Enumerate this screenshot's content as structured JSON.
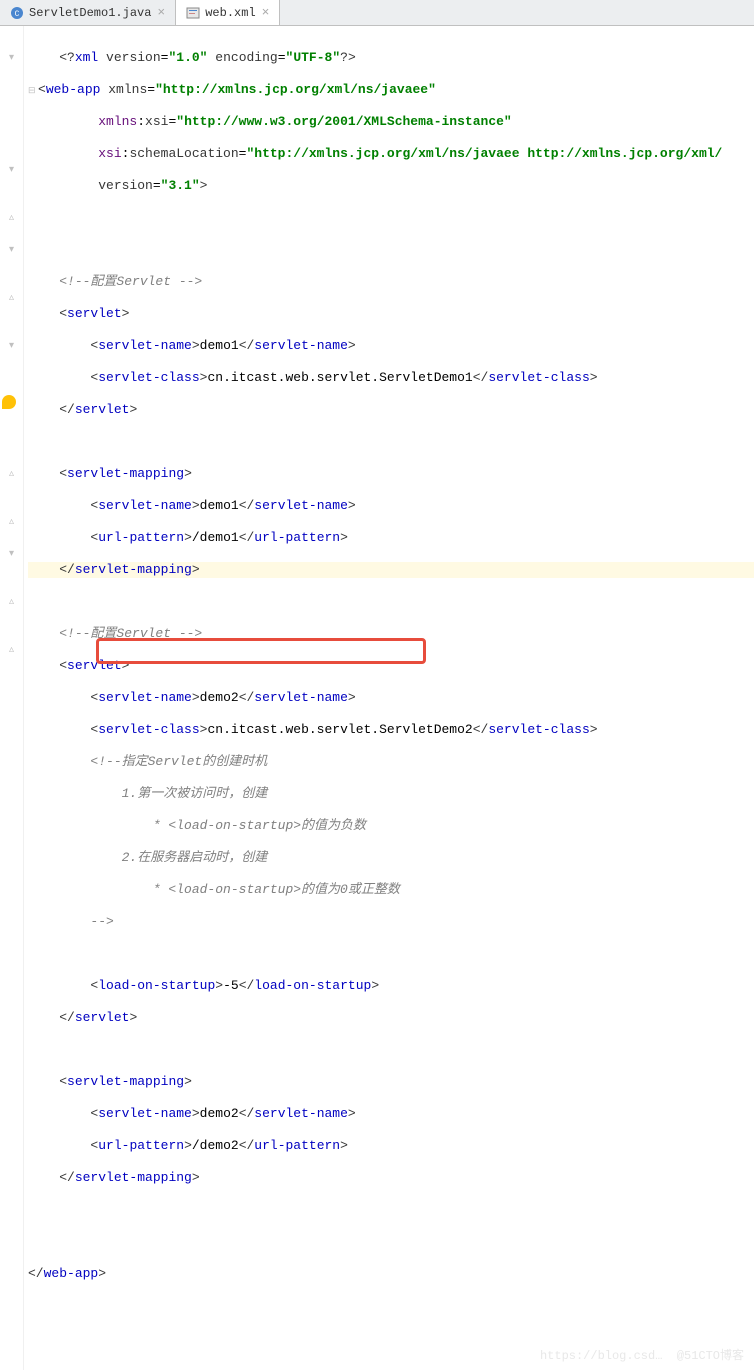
{
  "tabs": [
    {
      "label": "ServletDemo1.java",
      "active": false
    },
    {
      "label": "web.xml",
      "active": true
    }
  ],
  "code": {
    "l1": "<?xml version=\"1.0\" encoding=\"UTF-8\"?>",
    "l2_tag": "web-app",
    "l2_attr1": "xmlns",
    "l2_val1": "\"http://xmlns.jcp.org/xml/ns/javaee\"",
    "l3_attr": "xmlns:xsi",
    "l3_val": "\"http://www.w3.org/2001/XMLSchema-instance\"",
    "l4_attr": "xsi:schemaLocation",
    "l4_val": "\"http://xmlns.jcp.org/xml/ns/javaee http://xmlns.jcp.org/xml/",
    "l5_attr": "version",
    "l5_val": "\"3.1\"",
    "cmt1": "<!--配置Servlet -->",
    "servlet": "servlet",
    "servlet_name": "servlet-name",
    "servlet_class": "servlet-class",
    "servlet_mapping": "servlet-mapping",
    "url_pattern": "url-pattern",
    "load_on_startup": "load-on-startup",
    "demo1": "demo1",
    "demo2": "demo2",
    "class1": "cn.itcast.web.servlet.ServletDemo1",
    "class2": "cn.itcast.web.servlet.ServletDemo2",
    "urlp1": "/demo1",
    "urlp2": "/demo2",
    "los_val": "-5",
    "cmt2a": "<!--指定Servlet的创建时机",
    "cmt2b": "1.第一次被访问时，创建",
    "cmt2c": "* <load-on-startup>的值为负数",
    "cmt2d": "2.在服务器启动时，创建",
    "cmt2e": "* <load-on-startup>的值为0或正整数",
    "cmt2f": "-->",
    "web_app_close": "web-app"
  },
  "watermark": "https://blog.csd…  @51CTO博客"
}
